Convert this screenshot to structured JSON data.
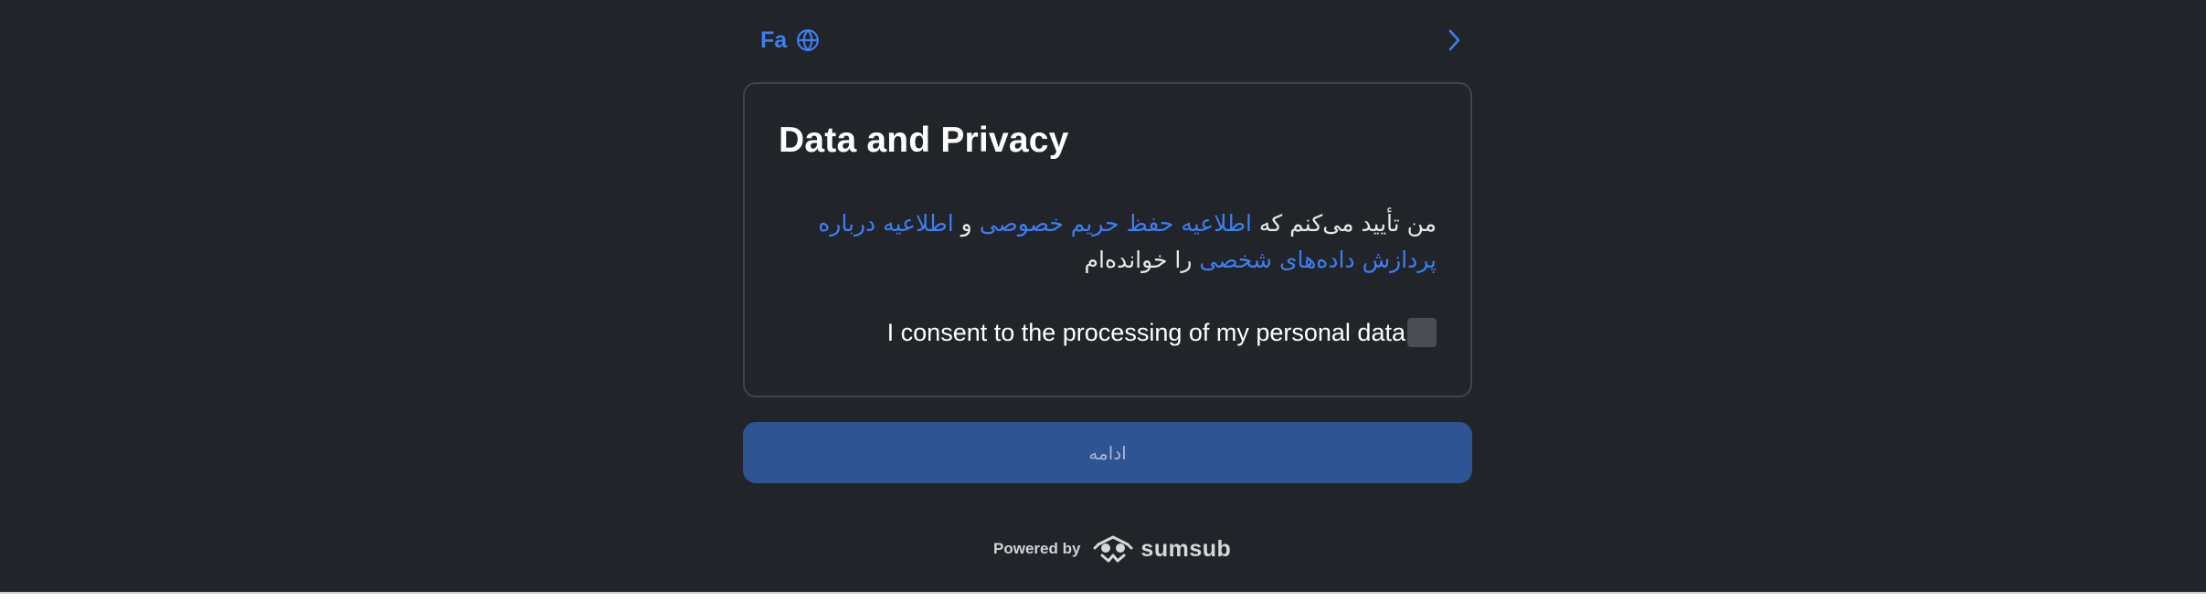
{
  "header": {
    "language_code": "Fa",
    "language_icon": "globe-icon",
    "next_icon": "chevron-right-icon"
  },
  "card": {
    "title": "Data and Privacy",
    "consent_text": {
      "part1": "من تأیید می‌کنم که ",
      "privacy_link": "اطلاعیه حفظ حریم خصوصی",
      "part2": " و ",
      "processing_link": "اطلاعیه درباره پردازش داده‌های شخصی",
      "part3": " را خوانده‌ام"
    },
    "checkbox_label": "I consent to the processing of my personal data",
    "checkbox_checked": false
  },
  "continue_button": {
    "label": "ادامه"
  },
  "footer": {
    "powered_by": "Powered by",
    "brand_name": "sumsub",
    "brand_icon": "sumsub-logo-icon"
  },
  "colors": {
    "background": "#212429",
    "accent": "#3f7ef2",
    "button": "#2e5493",
    "card_border": "#40444b"
  }
}
